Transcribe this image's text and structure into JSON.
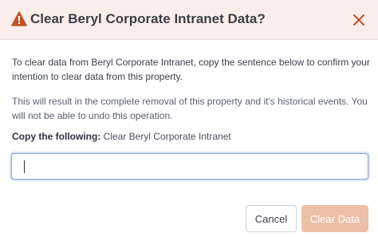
{
  "dialog": {
    "title": "Clear Beryl Corporate Intranet Data?",
    "icons": {
      "warning": "warning-triangle-icon",
      "close": "close-x-icon"
    },
    "intro": "To clear data from Beryl Corporate Intranet, copy the sentence below to confirm your intention to clear data from this property.",
    "warning_text": "This will result in the complete removal of this property and it's historical events. You will not be able to undo this operation.",
    "copy_label": "Copy the following:",
    "copy_phrase": "Clear Beryl Corporate Intranet",
    "input_value": "",
    "cancel_label": "Cancel",
    "confirm_label": "Clear Data"
  },
  "colors": {
    "header_bg": "#fbeeea",
    "accent": "#c0532a",
    "confirm_disabled": "#ecc0a7",
    "input_focus": "#8ea6d8"
  }
}
